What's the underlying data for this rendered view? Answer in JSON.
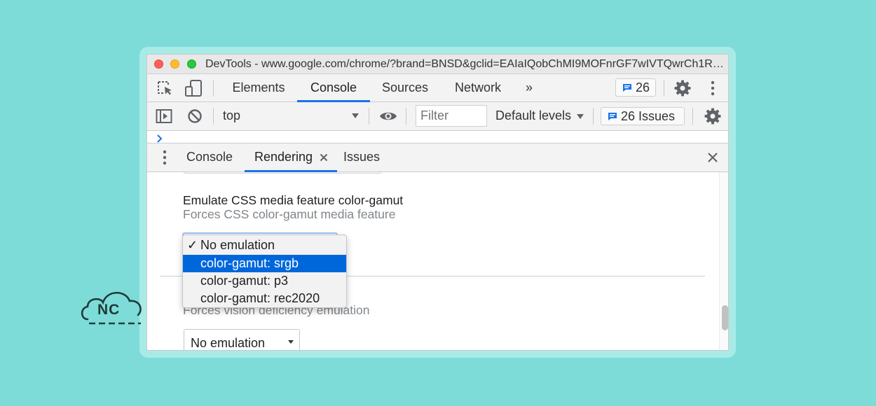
{
  "window": {
    "title": "DevTools - www.google.com/chrome/?brand=BNSD&gclid=EAIaIQobChMI9MOFnrGF7wIVTQwrCh1Rp..."
  },
  "main_tabs": {
    "elements": "Elements",
    "console": "Console",
    "sources": "Sources",
    "network": "Network",
    "more": "»"
  },
  "toolbar": {
    "message_count": "26",
    "context": "top",
    "filter_placeholder": "Filter",
    "levels": "Default levels",
    "issues_label": "26 Issues"
  },
  "drawer": {
    "tabs": {
      "console": "Console",
      "rendering": "Rendering",
      "issues": "Issues"
    }
  },
  "rendering": {
    "color_gamut": {
      "title": "Emulate CSS media feature color-gamut",
      "description": "Forces CSS color-gamut media feature",
      "options": [
        "No emulation",
        "color-gamut: srgb",
        "color-gamut: p3",
        "color-gamut: rec2020"
      ],
      "checked_index": 0,
      "highlighted_index": 1
    },
    "vision": {
      "description": "Forces vision deficiency emulation",
      "value": "No emulation"
    }
  },
  "logo": {
    "text": "NC"
  },
  "colors": {
    "accent": "#1a73e8",
    "highlight": "#0067db",
    "background": "#7ddcd8"
  }
}
